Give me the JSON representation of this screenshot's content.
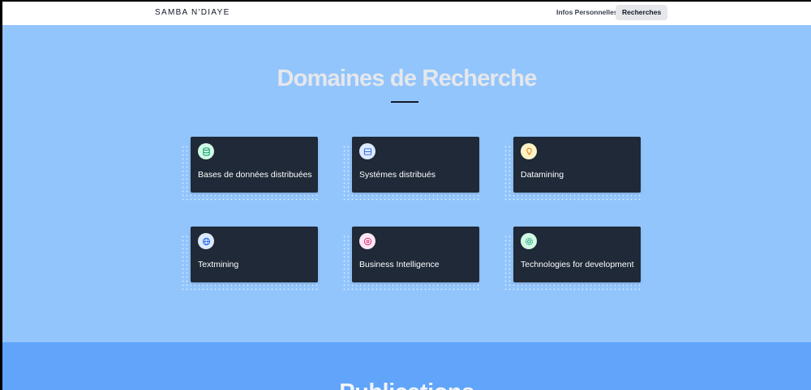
{
  "navbar": {
    "brand": "SAMBA N'DIAYE",
    "links": [
      {
        "label": "Infos Personnelles",
        "active": false
      },
      {
        "label": "Recherches",
        "active": true
      }
    ]
  },
  "research": {
    "title": "Domaines de Recherche",
    "background": "#93c5fd",
    "cards": [
      {
        "label": "Bases de données distribuées",
        "icon": "database-icon",
        "icon_color": "#059669"
      },
      {
        "label": "Systémes distribués",
        "icon": "server-icon",
        "icon_color": "#2563eb"
      },
      {
        "label": "Datamining",
        "icon": "lightbulb-icon",
        "icon_color": "#d97706"
      },
      {
        "label": "Textmining",
        "icon": "globe-icon",
        "icon_color": "#2563eb"
      },
      {
        "label": "Business Intelligence",
        "icon": "chart-icon",
        "icon_color": "#db2777"
      },
      {
        "label": "Technologies for development",
        "icon": "cog-icon",
        "icon_color": "#059669"
      }
    ]
  },
  "publications": {
    "title": "Publications",
    "background": "#60a5fa"
  }
}
